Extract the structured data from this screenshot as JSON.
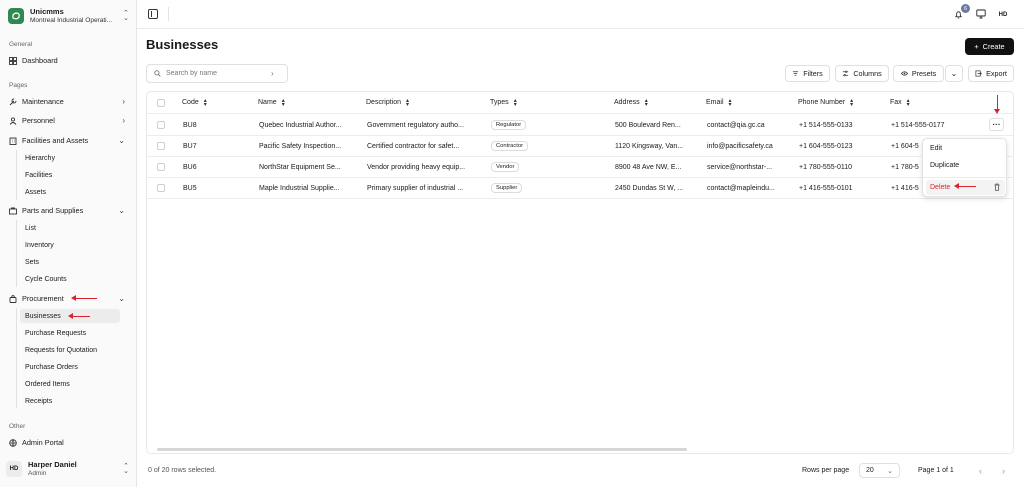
{
  "org": {
    "name": "Unicmms",
    "subtitle": "Montreal Industrial Operati..."
  },
  "sidebar": {
    "general_label": "General",
    "dashboard": "Dashboard",
    "pages_label": "Pages",
    "maintenance": "Maintenance",
    "personnel": "Personnel",
    "facilities": "Facilities and Assets",
    "facilities_sub": [
      "Hierarchy",
      "Facilities",
      "Assets"
    ],
    "parts": "Parts and Supplies",
    "parts_sub": [
      "List",
      "Inventory",
      "Sets",
      "Cycle Counts"
    ],
    "procurement": "Procurement",
    "procurement_sub": [
      "Businesses",
      "Purchase Requests",
      "Requests for Quotation",
      "Purchase Orders",
      "Ordered Items",
      "Receipts"
    ],
    "other_label": "Other",
    "admin": "Admin Portal"
  },
  "user": {
    "initials": "HD",
    "name": "Harper Daniel",
    "role": "Admin"
  },
  "header": {
    "notification_count": "6",
    "avatar": "HD"
  },
  "page": {
    "title": "Businesses",
    "create_label": "Create"
  },
  "toolbar": {
    "search_placeholder": "Search by name",
    "filters": "Filters",
    "columns": "Columns",
    "presets": "Presets",
    "export": "Export"
  },
  "table": {
    "columns": [
      "Code",
      "Name",
      "Description",
      "Types",
      "Address",
      "Email",
      "Phone Number",
      "Fax"
    ],
    "rows": [
      [
        "BU8",
        "Quebec Industrial Author...",
        "Government regulatory autho...",
        "Regulator",
        "500 Boulevard Ren...",
        "contact@qia.gc.ca",
        "+1 514-555-0133",
        "+1 514-555-0177"
      ],
      [
        "BU7",
        "Pacific Safety Inspection...",
        "Certified contractor for safet...",
        "Contractor",
        "1120 Kingsway, Van...",
        "info@pacificsafety.ca",
        "+1 604-555-0123",
        "+1 604-5"
      ],
      [
        "BU6",
        "NorthStar Equipment Se...",
        "Vendor providing heavy equip...",
        "Vendor",
        "8900 48 Ave NW, E...",
        "service@northstar-...",
        "+1 780-555-0110",
        "+1 780-5"
      ],
      [
        "BU5",
        "Maple Industrial Supplie...",
        "Primary supplier of industrial ...",
        "Supplier",
        "2450 Dundas St W, ...",
        "contact@mapleindu...",
        "+1 416-555-0101",
        "+1 416-5"
      ]
    ]
  },
  "row_menu": {
    "edit": "Edit",
    "duplicate": "Duplicate",
    "delete": "Delete"
  },
  "footer": {
    "selected": "0 of 20 rows selected.",
    "rows_per_page_label": "Rows per page",
    "rows_per_page": "20",
    "page_info": "Page 1 of 1"
  },
  "colors": {
    "accent": "#2f8a4f",
    "annotation": "#d9232d"
  }
}
